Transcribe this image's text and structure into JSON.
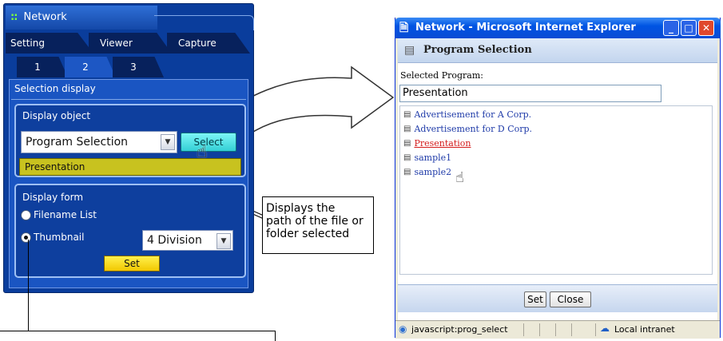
{
  "left_panel": {
    "title": "Network",
    "tabs": [
      "Setting",
      "Viewer",
      "Capture"
    ],
    "subtabs": [
      "1",
      "2",
      "3"
    ],
    "section_label": "Selection display",
    "display_object": {
      "label": "Display object",
      "selected": "Program Selection",
      "select_button": "Select",
      "path_value": "Presentation"
    },
    "display_form": {
      "label": "Display form",
      "options": [
        "Filename List",
        "Thumbnail"
      ],
      "division_selected": "4 Division",
      "set_button": "Set"
    }
  },
  "callout": {
    "line1": "Displays the",
    "line2": "path of the file or",
    "line3": "folder selected"
  },
  "ie_window": {
    "title": "Network - Microsoft Internet Explorer",
    "header": "Program Selection",
    "selected_label": "Selected Program:",
    "selected_value": "Presentation",
    "programs": [
      "Advertisement for A Corp.",
      "Advertisement for D Corp.",
      "Presentation",
      "sample1",
      "sample2"
    ],
    "set_button": "Set",
    "close_button": "Close",
    "status_text": "javascript:prog_select",
    "zone": "Local intranet"
  }
}
